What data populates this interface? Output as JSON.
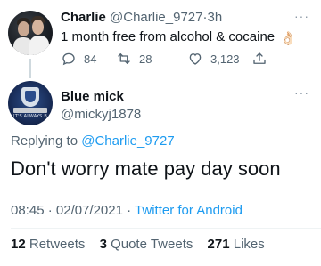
{
  "tweet1": {
    "display_name": "Charlie",
    "handle": "@Charlie_9727",
    "separator": "·",
    "time": "3h",
    "text": "1 month free from alcohol & cocaine",
    "emoji": "👌🏻",
    "replies": "84",
    "retweets": "28",
    "likes": "3,123",
    "more_label": "···"
  },
  "tweet2": {
    "display_name": "Blue mick",
    "handle": "@mickyj1878",
    "avatar_text": "IT'S ALWAYS B",
    "replying_prefix": "Replying to",
    "replying_to": "@Charlie_9727",
    "text": "Don't worry mate pay day soon",
    "time": "08:45",
    "date": "02/07/2021",
    "separator": "·",
    "client": "Twitter for Android",
    "more_label": "···",
    "retweets_count": "12",
    "retweets_label": "Retweets",
    "quotes_count": "3",
    "quotes_label": "Quote Tweets",
    "likes_count": "271",
    "likes_label": "Likes"
  },
  "colors": {
    "text": "#0f1419",
    "muted": "#536471",
    "link": "#1d9bf0",
    "divider": "#eff3f4"
  }
}
